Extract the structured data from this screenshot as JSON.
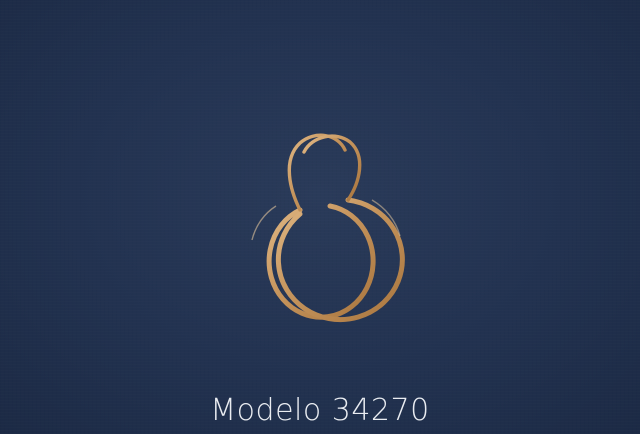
{
  "photo": {
    "subject": "gold-hoop-earrings",
    "background_color": "#223250",
    "metal_color": "#c99a63"
  },
  "caption": {
    "text": "Modelo 34270"
  }
}
